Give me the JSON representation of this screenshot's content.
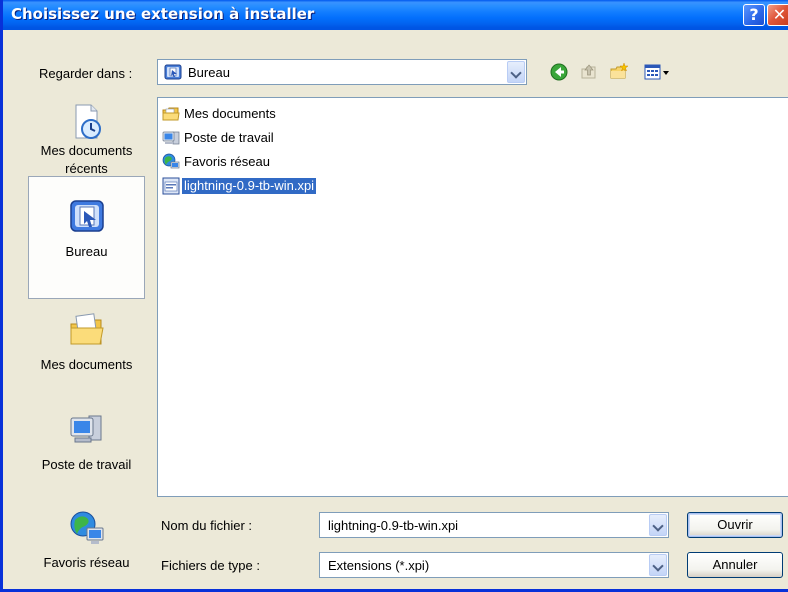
{
  "window": {
    "title": "Choisissez une extension à installer",
    "help_label": "?",
    "close_label": "✕"
  },
  "lookin": {
    "label": "Regarder dans :",
    "value": "Bureau"
  },
  "toolbar": {
    "icons": [
      "back-icon",
      "up-folder-icon",
      "new-folder-icon",
      "views-menu-icon"
    ]
  },
  "places": [
    {
      "label": "Mes documents récents",
      "icon": "recent-documents-icon"
    },
    {
      "label": "Bureau",
      "icon": "desktop-icon",
      "selected": true
    },
    {
      "label": "Mes documents",
      "icon": "my-documents-icon"
    },
    {
      "label": "Poste de travail",
      "icon": "my-computer-icon"
    },
    {
      "label": "Favoris réseau",
      "icon": "network-places-icon"
    }
  ],
  "files": [
    {
      "name": "Mes documents",
      "icon": "folder-icon"
    },
    {
      "name": "Poste de travail",
      "icon": "computer-icon"
    },
    {
      "name": "Favoris réseau",
      "icon": "network-icon"
    },
    {
      "name": "lightning-0.9-tb-win.xpi",
      "icon": "xpi-file-icon",
      "selected": true
    }
  ],
  "filename": {
    "label": "Nom du fichier :",
    "value": "lightning-0.9-tb-win.xpi"
  },
  "filetype": {
    "label": "Fichiers de type :",
    "value": "Extensions (*.xpi)"
  },
  "buttons": {
    "open": "Ouvrir",
    "cancel": "Annuler"
  },
  "colors": {
    "titlebar": "#0054e3",
    "selection": "#316ac5",
    "dialog_bg": "#ece9d8"
  }
}
